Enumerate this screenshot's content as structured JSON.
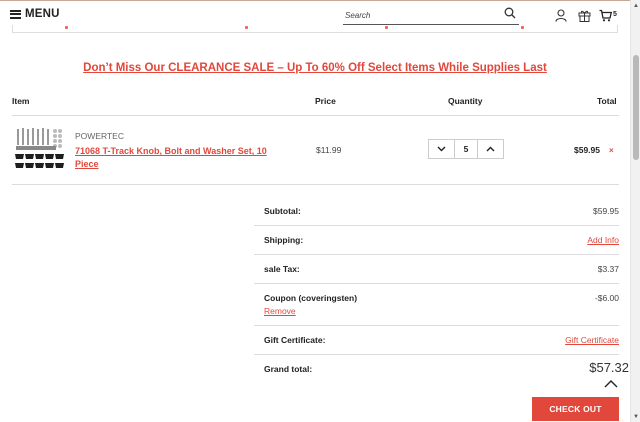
{
  "header": {
    "menu_label": "MENU",
    "search_placeholder": "Search",
    "cart_count": "5"
  },
  "promo_banner": "Don’t Miss Our CLEARANCE SALE – Up To 60% Off Select Items While Supplies Last",
  "table": {
    "headers": {
      "item": "Item",
      "price": "Price",
      "quantity": "Quantity",
      "total": "Total"
    }
  },
  "cart_item": {
    "brand": "POWERTEC",
    "name": "71068 T-Track Knob, Bolt and Washer Set, 10 Piece",
    "price": "$11.99",
    "quantity": "5",
    "total": "$59.95",
    "remove_symbol": "×"
  },
  "summary": {
    "subtotal_label": "Subtotal:",
    "subtotal_value": "$59.95",
    "shipping_label": "Shipping:",
    "shipping_link": "Add Info",
    "tax_label": "sale Tax:",
    "tax_value": "$3.37",
    "coupon_label": "Coupon (coveringsten)",
    "coupon_value": "-$6.00",
    "coupon_remove": "Remove",
    "gift_label": "Gift Certificate:",
    "gift_link": "Gift Certificate",
    "grand_label": "Grand total:",
    "grand_value": "$57.32"
  },
  "checkout_label": "CHECK OUT",
  "colors": {
    "accent": "#e2473b",
    "text": "#222222",
    "divider": "#dcdcdc"
  }
}
